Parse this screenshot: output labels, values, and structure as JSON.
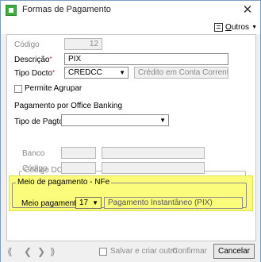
{
  "window": {
    "title": "Formas de Pagamento",
    "close_label": "✕"
  },
  "toolbar": {
    "more_label_first": "O",
    "more_label_rest": "utros"
  },
  "form": {
    "codigo_label": "Código",
    "codigo_value": "12",
    "descricao_label": "Descrição",
    "descricao_value": "PIX",
    "tipo_docto_label": "Tipo Docto",
    "tipo_docto_value": "CREDCC",
    "tipo_docto_desc": "Crédito em Conta Corrente",
    "permite_agrupar_label": "Permite Agrupar",
    "office_banking_label": "Pagamento por Office Banking",
    "tipo_pagto_label": "Tipo de Pagto",
    "tipo_pagto_value": "",
    "required_mark": "*"
  },
  "doc_ted": {
    "title": "Código DOC/TED",
    "banco_label": "Banco",
    "codigo_label": "Código",
    "banco_value": "",
    "banco_desc": "",
    "codigo_value": "",
    "codigo_desc": ""
  },
  "nfe": {
    "title": "Meio de pagamento - NFe",
    "meio_label": "Meio pagamento",
    "meio_code": "17",
    "meio_desc": "Pagamento Instantâneo (PIX)",
    "highlight_color": "#fbfb7c"
  },
  "bottom": {
    "nav_first": "⟪",
    "nav_prev": "❮",
    "nav_next": "❯",
    "nav_last": "⟫",
    "save_other_label": "Salvar e criar outro",
    "confirm_label": "Confirmar",
    "cancel_label": "Cancelar"
  }
}
